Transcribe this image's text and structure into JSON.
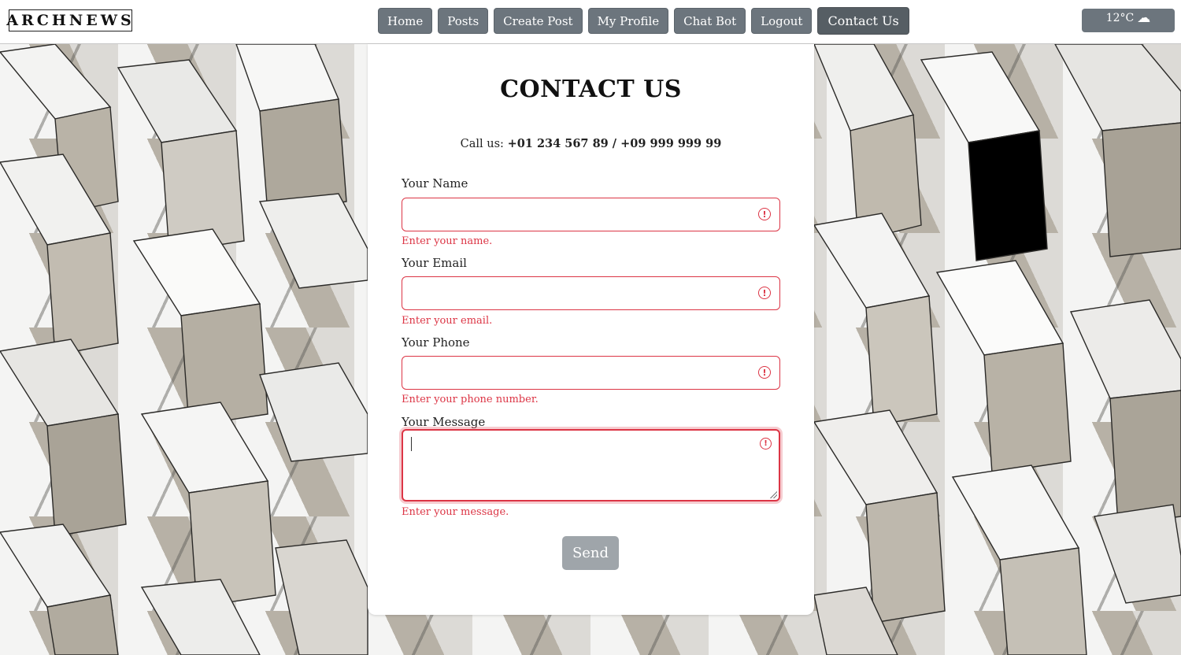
{
  "brand": {
    "logo": "ARCHNEWS"
  },
  "nav": {
    "items": [
      {
        "label": "Home"
      },
      {
        "label": "Posts"
      },
      {
        "label": "Create Post"
      },
      {
        "label": "My Profile"
      },
      {
        "label": "Chat Bot"
      },
      {
        "label": "Logout"
      },
      {
        "label": "Contact Us",
        "active": true
      }
    ]
  },
  "weather": {
    "temp": "12°C",
    "icon": "cloud-icon"
  },
  "contact": {
    "title": "CONTACT US",
    "call_prefix": "Call us: ",
    "call_numbers": "+01 234 567 89 / +09 999 999 99",
    "fields": {
      "name": {
        "label": "Your Name",
        "value": "",
        "error": "Enter your name."
      },
      "email": {
        "label": "Your Email",
        "value": "",
        "error": "Enter your email."
      },
      "phone": {
        "label": "Your Phone",
        "value": "",
        "error": "Enter your phone number."
      },
      "message": {
        "label": "Your Message",
        "value": "",
        "error": "Enter your message."
      }
    },
    "send_label": "Send"
  },
  "colors": {
    "nav_button": "#6c757d",
    "nav_button_active": "#565e64",
    "error": "#dc3545",
    "send_disabled": "#9fa5aa"
  }
}
